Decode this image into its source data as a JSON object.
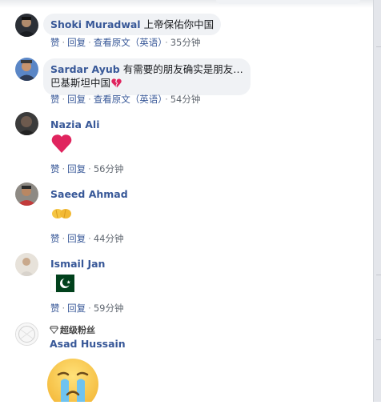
{
  "comments": [
    {
      "author": "Shoki Muradwal",
      "text": "上帝保佑你中国",
      "like": "赞",
      "reply": "回复",
      "translate": "查看原文（英语）",
      "time": "35分钟"
    },
    {
      "author": "Sardar Ayub",
      "text_line1": "有需要的朋友确实是朋友…",
      "text_line2": "巴基斯坦中国",
      "like": "赞",
      "reply": "回复",
      "translate": "查看原文（英语）",
      "time": "54分钟",
      "emoji": "broken-heart"
    },
    {
      "author": "Nazia Ali",
      "emoji": "red-heart",
      "like": "赞",
      "reply": "回复",
      "time": "56分钟"
    },
    {
      "author": "Saeed Ahmad",
      "emoji": "praying-hands",
      "like": "赞",
      "reply": "回复",
      "time": "44分钟"
    },
    {
      "author": "Ismail Jan",
      "emoji": "pakistan-flag",
      "like": "赞",
      "reply": "回复",
      "time": "59分钟"
    },
    {
      "badge": "超级粉丝",
      "author": "Asad Hussain",
      "emoji": "crying-face"
    }
  ],
  "colors": {
    "link": "#385898",
    "bubble": "#f0f2f5",
    "meta": "#606770",
    "heart": "#e0245e"
  }
}
